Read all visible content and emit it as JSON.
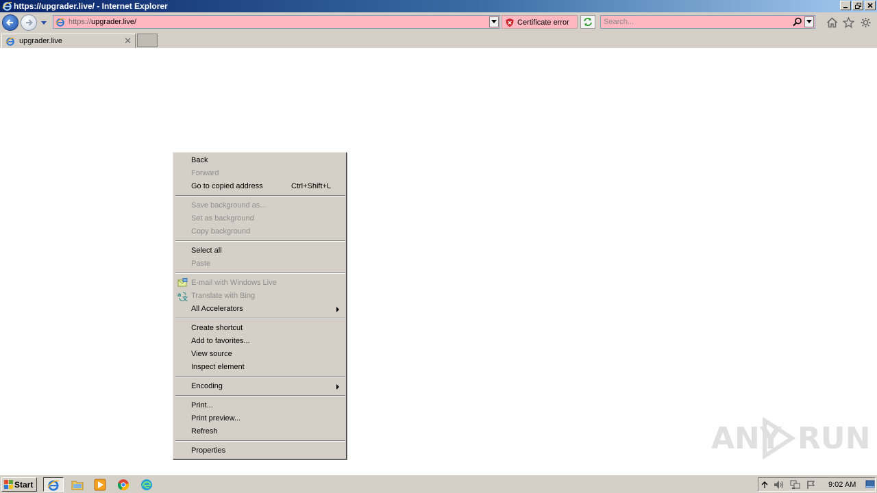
{
  "window": {
    "title": "https://upgrader.live/ - Internet Explorer"
  },
  "navbar": {
    "url_protocol": "https://",
    "url_host": "upgrader.live/",
    "certificate_label": "Certificate error",
    "search_placeholder": "Search..."
  },
  "tabs": [
    {
      "label": "upgrader.live"
    }
  ],
  "context_menu": {
    "items": [
      {
        "label": "Back",
        "enabled": true
      },
      {
        "label": "Forward",
        "enabled": false
      },
      {
        "label": "Go to copied address",
        "shortcut": "Ctrl+Shift+L",
        "enabled": true
      },
      {
        "label": "Save background as...",
        "enabled": false
      },
      {
        "label": "Set as background",
        "enabled": false
      },
      {
        "label": "Copy background",
        "enabled": false
      },
      {
        "label": "Select all",
        "enabled": true
      },
      {
        "label": "Paste",
        "enabled": false
      },
      {
        "label": "E-mail with Windows Live",
        "enabled": false,
        "icon": "email-live-icon"
      },
      {
        "label": "Translate with Bing",
        "enabled": false,
        "icon": "translate-icon"
      },
      {
        "label": "All Accelerators",
        "enabled": true,
        "submenu": true
      },
      {
        "label": "Create shortcut",
        "enabled": true
      },
      {
        "label": "Add to favorites...",
        "enabled": true
      },
      {
        "label": "View source",
        "enabled": true
      },
      {
        "label": "Inspect element",
        "enabled": true
      },
      {
        "label": "Encoding",
        "enabled": true,
        "submenu": true
      },
      {
        "label": "Print...",
        "enabled": true
      },
      {
        "label": "Print preview...",
        "enabled": true
      },
      {
        "label": "Refresh",
        "enabled": true
      },
      {
        "label": "Properties",
        "enabled": true
      }
    ]
  },
  "watermark": {
    "left": "ANY",
    "right": "RUN"
  },
  "taskbar": {
    "start_label": "Start",
    "apps": [
      "internet-explorer-icon",
      "file-explorer-icon",
      "media-player-icon",
      "chrome-icon",
      "edge-icon"
    ],
    "clock": "9:02 AM"
  },
  "colors": {
    "chrome_gray": "#d4d0c8",
    "address_error_pink": "#ffb7c0",
    "title_blue": "#0a246a"
  }
}
